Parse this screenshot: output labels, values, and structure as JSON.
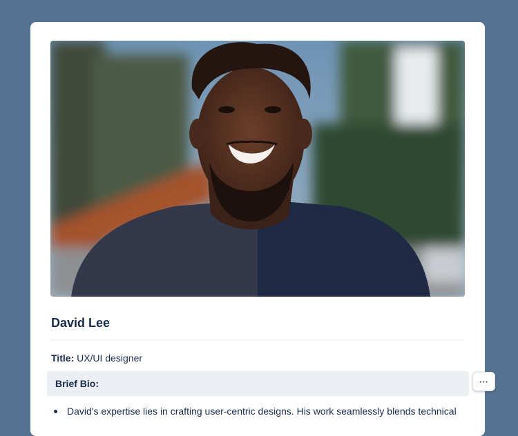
{
  "profile": {
    "name": "David Lee",
    "title_label": "Title:",
    "title_value": "UX/UI designer",
    "bio_heading": "Brief Bio:",
    "bio_items": [
      "David's expertise lies in crafting user-centric designs. His work seamlessly blends technical"
    ]
  },
  "actions": {
    "more_label": "···"
  },
  "colors": {
    "background": "#557290",
    "card": "#ffffff",
    "bio_header_bg": "#ebeff3",
    "text": "#172b4d"
  },
  "icons": {
    "more": "more-horizontal-icon"
  }
}
